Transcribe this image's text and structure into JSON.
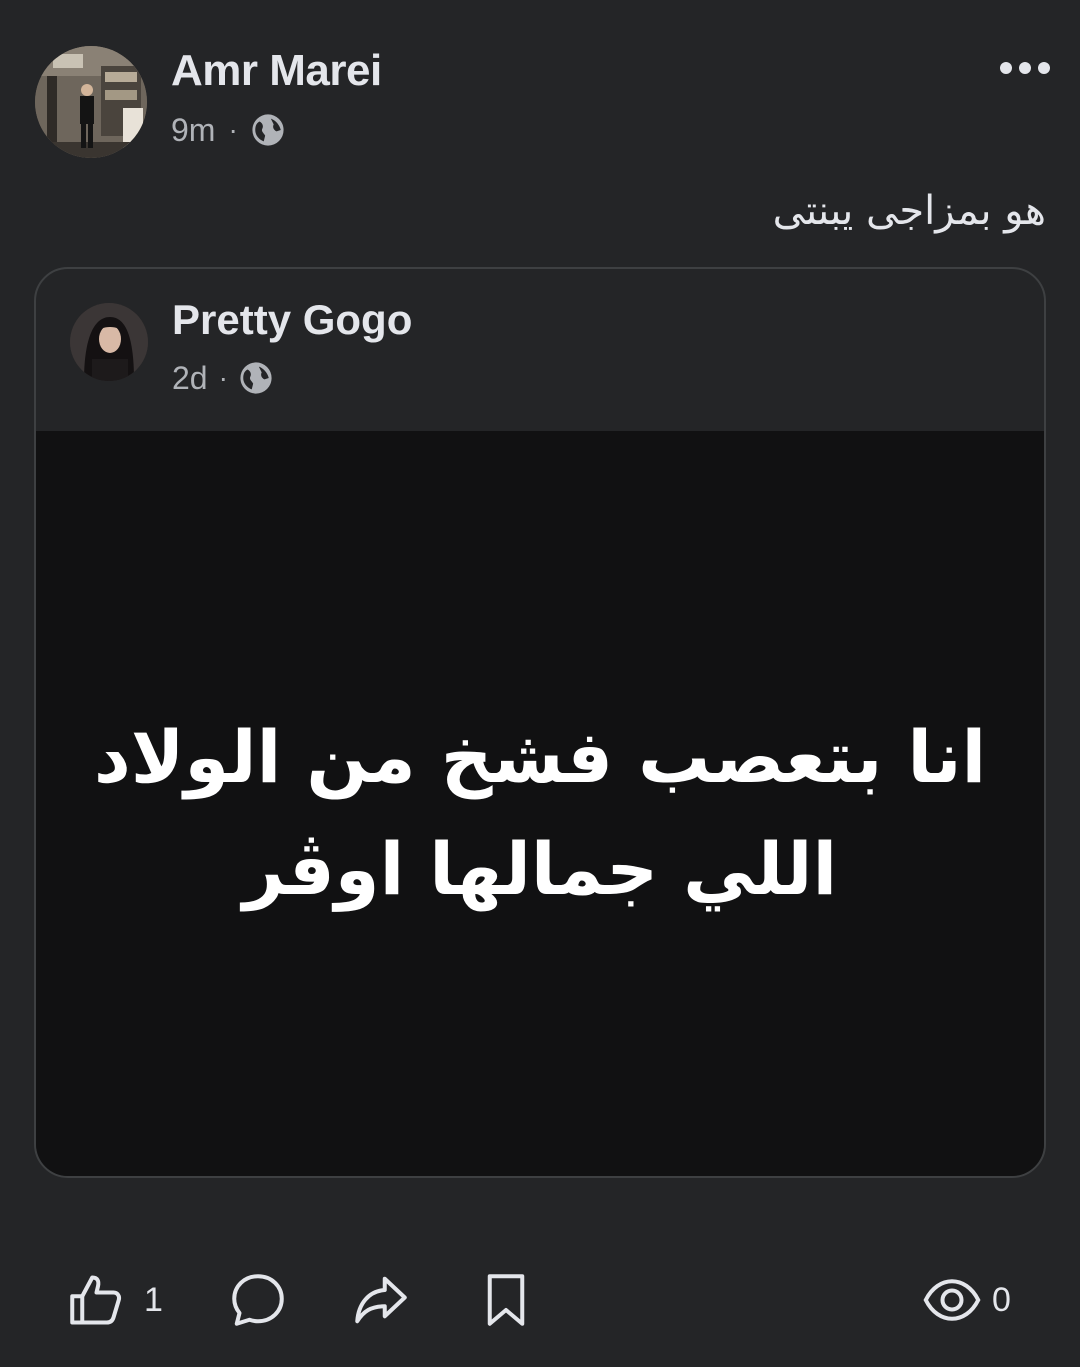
{
  "post": {
    "author": "Amr Marei",
    "time": "9m",
    "separator": "·",
    "audience_icon": "globe-icon",
    "caption": "هو بمزاجى يبنتى",
    "more_icon": "more-horizontal-icon"
  },
  "shared": {
    "author": "Pretty Gogo",
    "time": "2d",
    "separator": "·",
    "audience_icon": "globe-icon",
    "image_text_lines": [
      "انا بتعصب فشخ من الولاد",
      "اللي جمالها اوڤر"
    ]
  },
  "actions": {
    "like_count": "1",
    "view_count": "0"
  },
  "colors": {
    "background": "#242527",
    "image_background": "#111112",
    "text_primary": "#e4e6eb",
    "text_secondary": "#b0b3b8",
    "border": "#3e4042"
  }
}
